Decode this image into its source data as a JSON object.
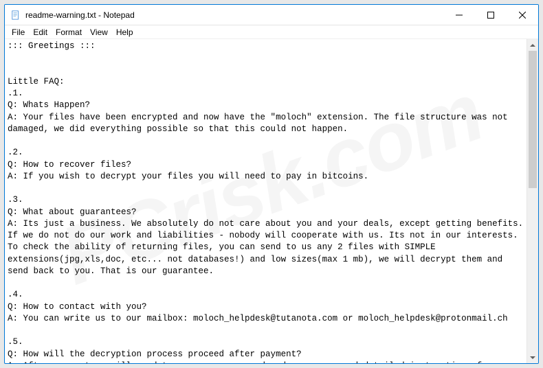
{
  "window": {
    "title": "readme-warning.txt - Notepad"
  },
  "menu": {
    "file": "File",
    "edit": "Edit",
    "format": "Format",
    "view": "View",
    "help": "Help"
  },
  "document": {
    "text": "::: Greetings :::\n\n\nLittle FAQ:\n.1.\nQ: Whats Happen?\nA: Your files have been encrypted and now have the \"moloch\" extension. The file structure was not damaged, we did everything possible so that this could not happen.\n\n.2.\nQ: How to recover files?\nA: If you wish to decrypt your files you will need to pay in bitcoins.\n\n.3.\nQ: What about guarantees?\nA: Its just a business. We absolutely do not care about you and your deals, except getting benefits. If we do not do our work and liabilities - nobody will cooperate with us. Its not in our interests.\nTo check the ability of returning files, you can send to us any 2 files with SIMPLE extensions(jpg,xls,doc, etc... not databases!) and low sizes(max 1 mb), we will decrypt them and send back to you. That is our guarantee.\n\n.4.\nQ: How to contact with you?\nA: You can write us to our mailbox: moloch_helpdesk@tutanota.com or moloch_helpdesk@protonmail.ch\n\n.5.\nQ: How will the decryption process proceed after payment?\nA: After payment we will send to you our scanner-decoder program and detailed instructions for use. With this program you will be able to decrypt all your encrypted files."
  },
  "watermark": "PCrisk.com"
}
